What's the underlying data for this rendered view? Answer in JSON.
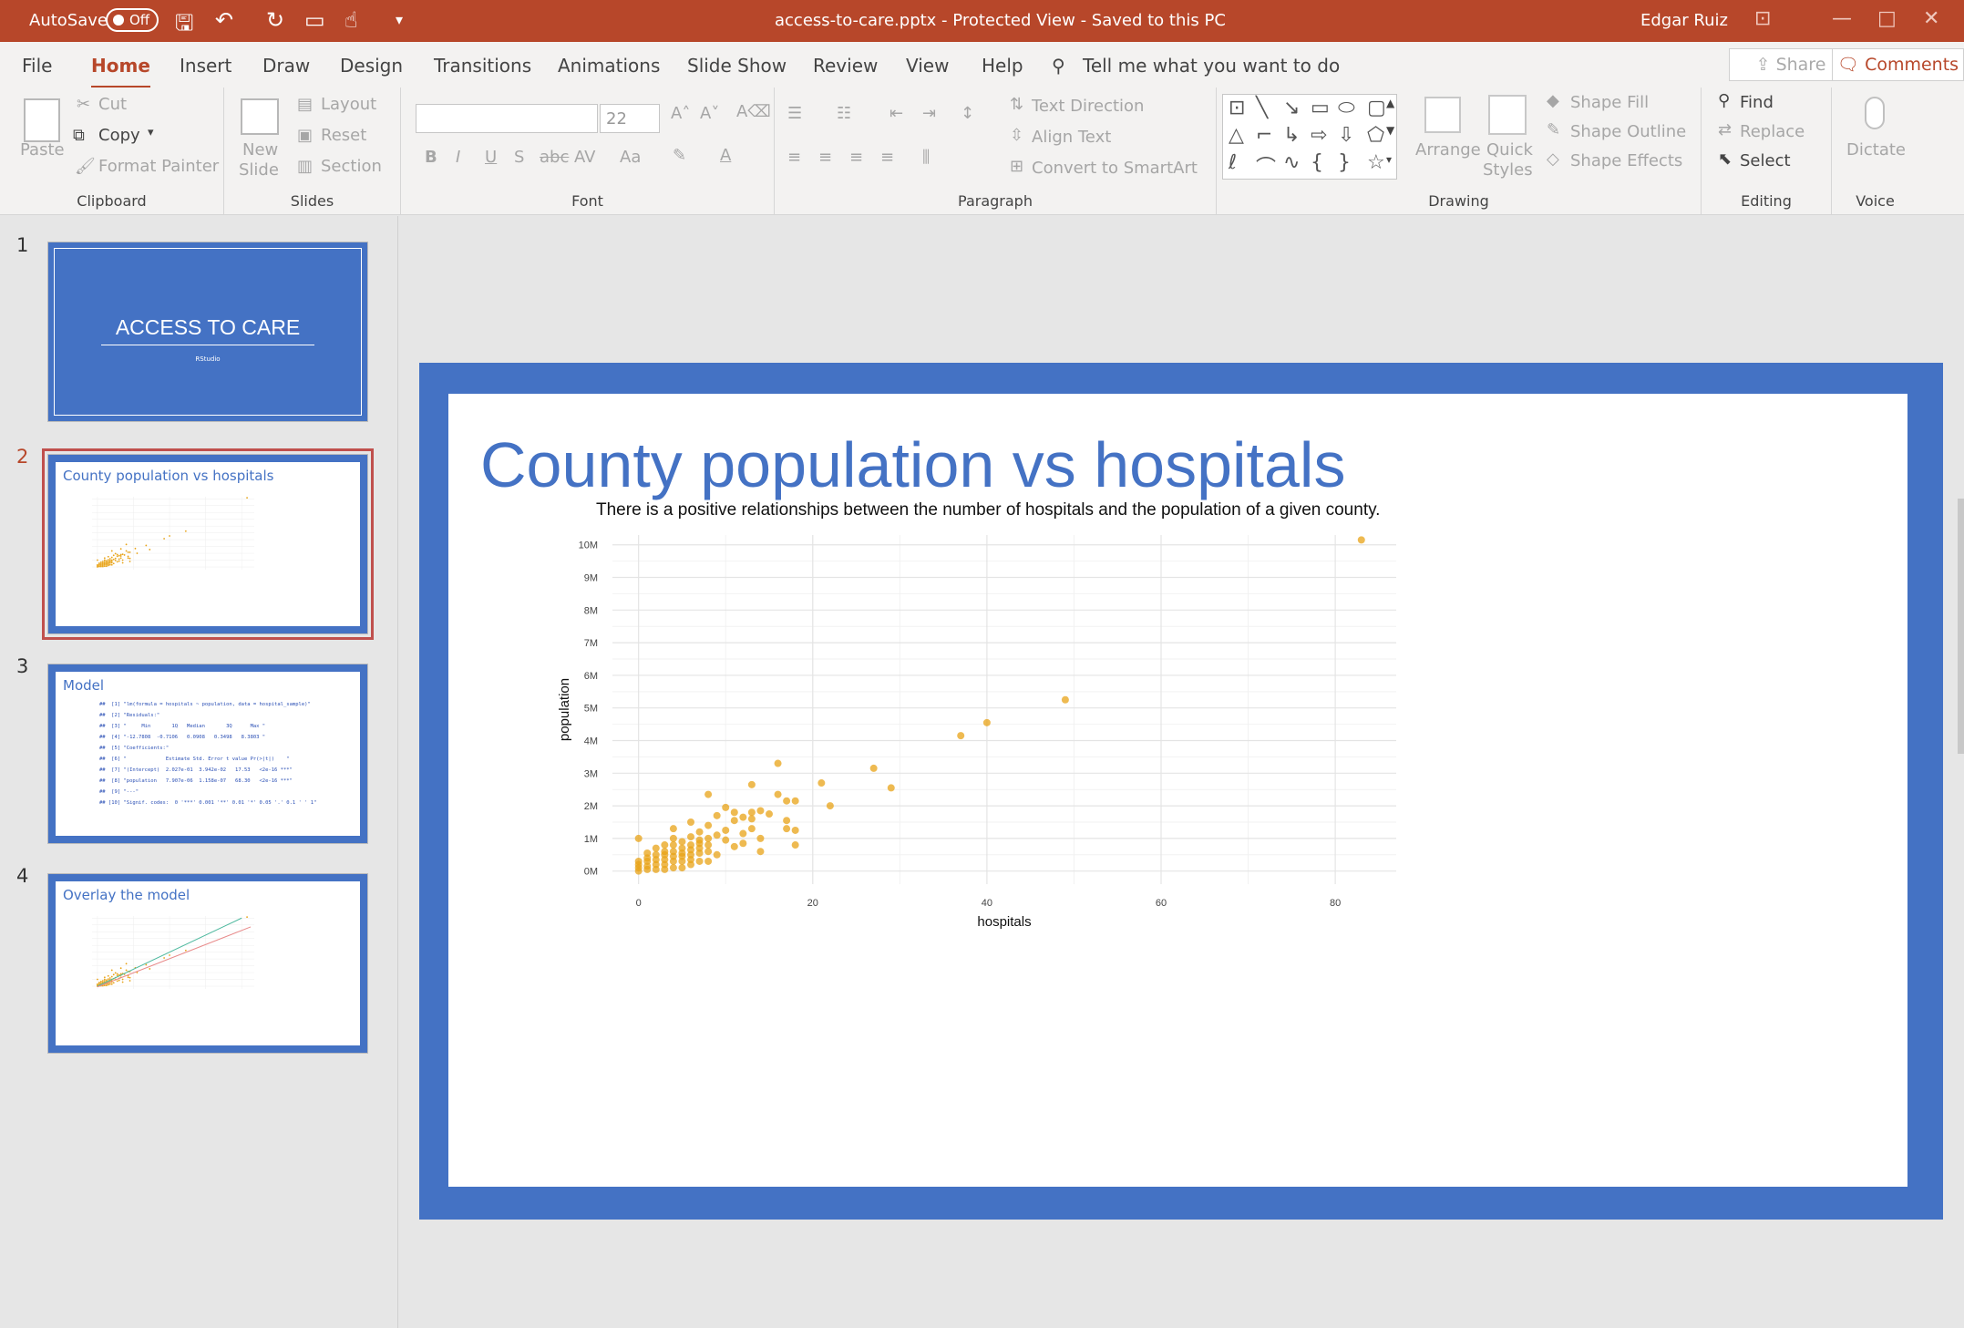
{
  "titlebar": {
    "autosave_label": "AutoSave",
    "autosave_state": "Off",
    "doc_title": "access-to-care.pptx  -  Protected View  -  Saved to this PC",
    "user": "Edgar Ruiz"
  },
  "tabs": {
    "items": [
      "File",
      "Home",
      "Insert",
      "Draw",
      "Design",
      "Transitions",
      "Animations",
      "Slide Show",
      "Review",
      "View",
      "Help"
    ],
    "active": "Home",
    "tell_me": "Tell me what you want to do",
    "share": "Share",
    "comments": "Comments"
  },
  "ribbon": {
    "clipboard": {
      "label": "Clipboard",
      "paste": "Paste",
      "cut": "Cut",
      "copy": "Copy",
      "format_painter": "Format Painter"
    },
    "slides": {
      "label": "Slides",
      "new": "New",
      "slide": "Slide",
      "layout": "Layout",
      "reset": "Reset",
      "section": "Section"
    },
    "font": {
      "label": "Font",
      "font_name": "",
      "font_size": "22",
      "change_case": "Aa"
    },
    "paragraph": {
      "label": "Paragraph",
      "text_direction": "Text Direction",
      "align_text": "Align Text",
      "convert_smartart": "Convert to SmartArt"
    },
    "drawing": {
      "label": "Drawing",
      "arrange": "Arrange",
      "quick": "Quick",
      "styles": "Styles",
      "shape_fill": "Shape Fill",
      "shape_outline": "Shape Outline",
      "shape_effects": "Shape Effects"
    },
    "editing": {
      "label": "Editing",
      "find": "Find",
      "replace": "Replace",
      "select": "Select"
    },
    "voice": {
      "label": "Voice",
      "dictate": "Dictate"
    }
  },
  "thumbnails": [
    {
      "num": "1",
      "title": "ACCESS TO CARE",
      "subtitle": "RStudio"
    },
    {
      "num": "2",
      "title": "County population vs hospitals"
    },
    {
      "num": "3",
      "title": "Model",
      "lines": [
        "##  [1] \"lm(formula = hospitals ~ population, data = hospital_sample)\"",
        "##  [2] \"Residuals:\"",
        "##  [3] \"     Min       1Q   Median       3Q      Max \"",
        "##  [4] \"-12.7808  -0.7106   0.0908   0.3498   8.3803 \"",
        "##  [5] \"Coefficients:\"",
        "##  [6] \"             Estimate Std. Error t value Pr(>|t|)    \"",
        "##  [7] \"(Intercept)  2.027e-01  3.942e-02   17.53   <2e-16 ***\"",
        "##  [8] \"population   7.907e-06  1.158e-07   68.30   <2e-16 ***\"",
        "##  [9] \"---\"",
        "## [10] \"Signif. codes:  0 '***' 0.001 '**' 0.01 '*' 0.05 '.' 0.1 ' ' 1\""
      ]
    },
    {
      "num": "4",
      "title": "Overlay the model"
    }
  ],
  "slide": {
    "title": "County population vs hospitals"
  },
  "chart_data": {
    "type": "scatter",
    "title": "There is a positive relationships between the number of hospitals and the population of a given county.",
    "xlabel": "hospitals",
    "ylabel": "population",
    "xlim": [
      -3,
      87
    ],
    "ylim": [
      -0.4,
      10.3
    ],
    "x_ticks": [
      0,
      20,
      40,
      60,
      80
    ],
    "y_ticks": [
      0,
      1,
      2,
      3,
      4,
      5,
      6,
      7,
      8,
      9,
      10
    ],
    "y_tick_labels": [
      "0M",
      "1M",
      "2M",
      "3M",
      "4M",
      "5M",
      "6M",
      "7M",
      "8M",
      "9M",
      "10M"
    ],
    "grid": true,
    "point_color": "#e8a317",
    "points": [
      [
        83,
        10.15
      ],
      [
        49,
        5.25
      ],
      [
        40,
        4.55
      ],
      [
        37,
        4.15
      ],
      [
        27,
        3.15
      ],
      [
        29,
        2.55
      ],
      [
        21,
        2.7
      ],
      [
        22,
        2.0
      ],
      [
        16,
        3.3
      ],
      [
        16,
        2.35
      ],
      [
        17,
        2.15
      ],
      [
        18,
        2.15
      ],
      [
        17,
        1.55
      ],
      [
        17,
        1.3
      ],
      [
        18,
        1.25
      ],
      [
        18,
        0.8
      ],
      [
        13,
        2.65
      ],
      [
        14,
        1.85
      ],
      [
        13,
        1.8
      ],
      [
        15,
        1.75
      ],
      [
        12,
        1.65
      ],
      [
        13,
        1.6
      ],
      [
        11,
        1.55
      ],
      [
        13,
        1.3
      ],
      [
        12,
        1.15
      ],
      [
        14,
        1.0
      ],
      [
        12,
        0.85
      ],
      [
        14,
        0.6
      ],
      [
        8,
        2.35
      ],
      [
        10,
        1.95
      ],
      [
        11,
        1.8
      ],
      [
        9,
        1.7
      ],
      [
        6,
        1.5
      ],
      [
        7,
        1.2
      ],
      [
        8,
        1.4
      ],
      [
        9,
        1.1
      ],
      [
        10,
        1.25
      ],
      [
        10,
        0.95
      ],
      [
        11,
        0.75
      ],
      [
        9,
        0.5
      ],
      [
        8,
        0.3
      ],
      [
        0,
        1.0
      ],
      [
        2,
        0.7
      ],
      [
        3,
        0.5
      ],
      [
        4,
        1.3
      ],
      [
        4,
        1.0
      ],
      [
        5,
        0.9
      ],
      [
        6,
        1.05
      ],
      [
        5,
        0.7
      ],
      [
        7,
        0.85
      ],
      [
        6,
        0.5
      ],
      [
        1,
        0.3
      ],
      [
        2,
        0.2
      ],
      [
        3,
        0.35
      ],
      [
        4,
        0.45
      ],
      [
        5,
        0.55
      ],
      [
        6,
        0.65
      ],
      [
        7,
        0.55
      ],
      [
        8,
        0.6
      ],
      [
        0,
        0.0
      ],
      [
        0,
        0.1
      ],
      [
        0,
        0.2
      ],
      [
        0,
        0.3
      ],
      [
        1,
        0.05
      ],
      [
        1,
        0.15
      ],
      [
        1,
        0.4
      ],
      [
        1,
        0.55
      ],
      [
        2,
        0.05
      ],
      [
        2,
        0.35
      ],
      [
        2,
        0.5
      ],
      [
        3,
        0.05
      ],
      [
        3,
        0.2
      ],
      [
        3,
        0.6
      ],
      [
        3,
        0.8
      ],
      [
        4,
        0.1
      ],
      [
        4,
        0.3
      ],
      [
        4,
        0.6
      ],
      [
        4,
        0.8
      ],
      [
        5,
        0.1
      ],
      [
        5,
        0.3
      ],
      [
        5,
        0.45
      ],
      [
        6,
        0.2
      ],
      [
        6,
        0.35
      ],
      [
        6,
        0.8
      ],
      [
        7,
        0.3
      ],
      [
        7,
        0.7
      ],
      [
        7,
        0.95
      ],
      [
        8,
        0.8
      ],
      [
        8,
        1.0
      ]
    ]
  },
  "colors": {
    "accent": "#b7472a",
    "slide_blue": "#4472c4",
    "point": "#e8a317"
  }
}
